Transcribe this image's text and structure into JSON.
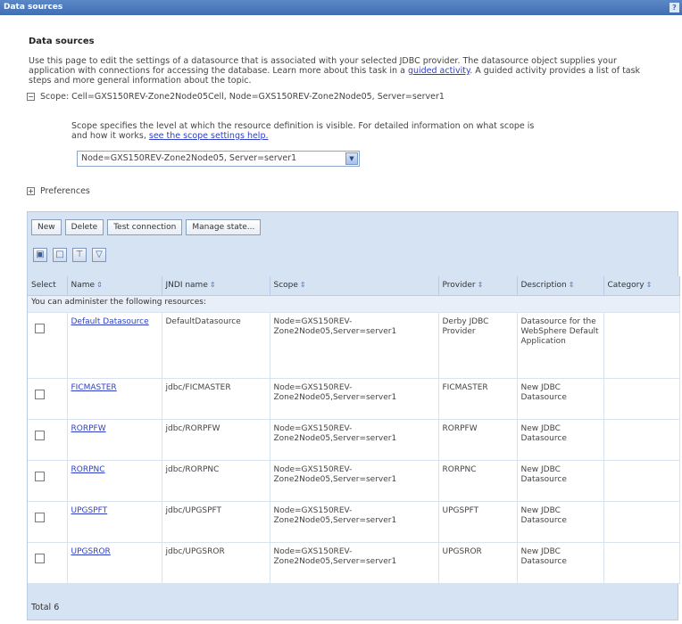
{
  "window": {
    "title": "Data sources",
    "help_icon": "?"
  },
  "page": {
    "heading": "Data sources",
    "description_part1": "Use this page to edit the settings of a datasource that is associated with your selected JDBC provider. The datasource object supplies your application with connections for accessing the database. Learn more about this task in a ",
    "description_link": "guided activity",
    "description_part2": ". A guided activity provides a list of task steps and more general information about the topic."
  },
  "scope": {
    "label": "Scope: Cell=GXS150REV-Zone2Node05Cell, Node=GXS150REV-Zone2Node05, Server=server1",
    "help_text": "Scope specifies the level at which the resource definition is visible. For detailed information on what scope is and how it works, ",
    "help_link": "see the scope settings help.",
    "selected": "Node=GXS150REV-Zone2Node05, Server=server1"
  },
  "preferences": {
    "label": "Preferences"
  },
  "buttons": {
    "new": "New",
    "delete": "Delete",
    "test_connection": "Test connection",
    "manage_state": "Manage state..."
  },
  "icons": [
    "select-all-icon",
    "deselect-all-icon",
    "show-filter-icon",
    "hide-filter-icon"
  ],
  "table": {
    "headers": [
      "Select",
      "Name",
      "JNDI name",
      "Scope",
      "Provider",
      "Description",
      "Category"
    ],
    "admin_text": "You can administer the following resources:",
    "rows": [
      {
        "name": "Default Datasource",
        "jndi": "DefaultDatasource",
        "scope": "Node=GXS150REV-Zone2Node05,Server=server1",
        "provider": "Derby JDBC Provider",
        "description": "Datasource for the WebSphere Default Application",
        "category": ""
      },
      {
        "name": "FICMASTER",
        "jndi": "jdbc/FICMASTER",
        "scope": "Node=GXS150REV-Zone2Node05,Server=server1",
        "provider": "FICMASTER",
        "description": "New JDBC Datasource",
        "category": ""
      },
      {
        "name": "RORPFW",
        "jndi": "jdbc/RORPFW",
        "scope": "Node=GXS150REV-Zone2Node05,Server=server1",
        "provider": "RORPFW",
        "description": "New JDBC Datasource",
        "category": ""
      },
      {
        "name": "RORPNC",
        "jndi": "jdbc/RORPNC",
        "scope": "Node=GXS150REV-Zone2Node05,Server=server1",
        "provider": "RORPNC",
        "description": "New JDBC Datasource",
        "category": ""
      },
      {
        "name": "UPGSPFT",
        "jndi": "jdbc/UPGSPFT",
        "scope": "Node=GXS150REV-Zone2Node05,Server=server1",
        "provider": "UPGSPFT",
        "description": "New JDBC Datasource",
        "category": ""
      },
      {
        "name": "UPGSROR",
        "jndi": "jdbc/UPGSROR",
        "scope": "Node=GXS150REV-Zone2Node05,Server=server1",
        "provider": "UPGSROR",
        "description": "New JDBC Datasource",
        "category": ""
      }
    ],
    "total": "Total 6"
  }
}
